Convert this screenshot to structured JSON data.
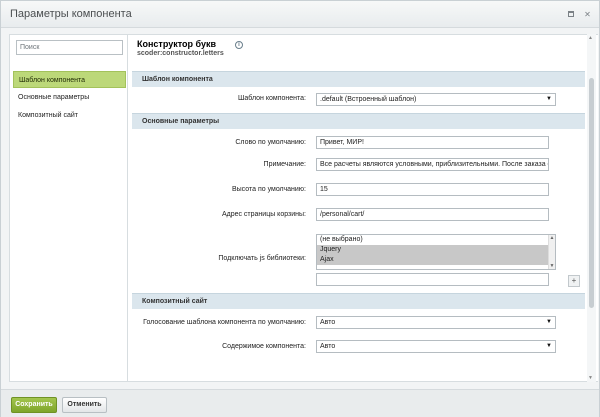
{
  "window": {
    "title": "Параметры компонента",
    "maximize_icon": "maximize-icon",
    "close_icon": "close-icon",
    "close_glyph": "✕"
  },
  "sidebar": {
    "search_placeholder": "Поиск",
    "items": [
      {
        "label": "Шаблон компонента",
        "active": true
      },
      {
        "label": "Основные параметры",
        "active": false
      },
      {
        "label": "Композитный сайт",
        "active": false
      }
    ]
  },
  "component": {
    "title": "Конструктор букв",
    "code": "scoder:constructor.letters",
    "info_glyph": "i"
  },
  "sections": {
    "template": {
      "title": "Шаблон компонента",
      "template_label": "Шаблон компонента:",
      "template_value": ".default (Встроенный шаблон)"
    },
    "main": {
      "title": "Основные параметры",
      "default_word_label": "Слово по умолчанию:",
      "default_word_value": "Привет, МИР!",
      "note_label": "Примечание:",
      "note_value": "Все расчеты являются условными, приблизительными. После заказа с вами",
      "height_label": "Высота по умолчанию:",
      "height_value": "15",
      "cart_label": "Адрес страницы корзины:",
      "cart_value": "/personal/cart/",
      "js_label": "Подключать js библиотеки:",
      "js_options": [
        {
          "label": "(не выбрано)",
          "selected": false
        },
        {
          "label": "Jquery",
          "selected": true
        },
        {
          "label": "Ajax",
          "selected": true
        }
      ],
      "add_glyph": "+"
    },
    "composite": {
      "title": "Композитный сайт",
      "voting_label": "Голосование шаблона компонента по умолчанию:",
      "voting_value": "Авто",
      "content_label": "Содержимое компонента:",
      "content_value": "Авто"
    }
  },
  "footer": {
    "save_label": "Сохранить",
    "cancel_label": "Отменить"
  },
  "colors": {
    "accent_green": "#8bb234",
    "section_bg": "#dbe6ed",
    "active_nav": "#bcd879"
  }
}
